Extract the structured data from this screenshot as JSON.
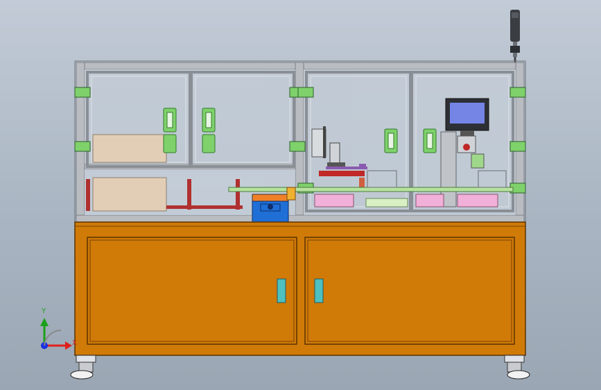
{
  "triad": {
    "x_label": "X",
    "y_label": "Y",
    "x_color": "#e0201b",
    "y_color": "#1aa01a",
    "z_color": "#1b2fe0"
  },
  "colors": {
    "background": "#b3bdc9",
    "frame": "#b5b9be",
    "cabinet": "#d07a08",
    "glass": "#c0cad4",
    "handle": "#4ec0c0",
    "hinge": "#3cb371",
    "pink_tray": "#f0a8d8",
    "green_rail": "#9fd88a",
    "blue_box": "#1f6fd6"
  },
  "hmi": {
    "icon": "touch-screen-icon"
  },
  "tower_light": {
    "icon": "signal-tower-icon"
  }
}
